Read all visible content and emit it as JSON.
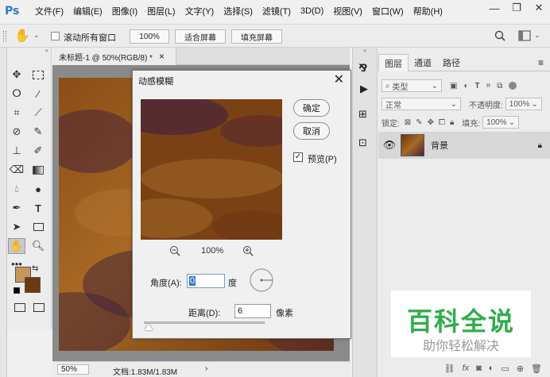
{
  "app": {
    "logo": "Ps"
  },
  "menu": [
    "文件(F)",
    "编辑(E)",
    "图像(I)",
    "图层(L)",
    "文字(Y)",
    "选择(S)",
    "滤镜(T)",
    "3D(D)",
    "视图(V)",
    "窗口(W)",
    "帮助(H)"
  ],
  "window_controls": {
    "minimize": "—",
    "restore": "❐",
    "close": "✕"
  },
  "options_bar": {
    "scroll_all_label": "滚动所有窗口",
    "zoom_value": "100%",
    "fit_screen_label": "适合屏幕",
    "fill_screen_label": "填充屏幕"
  },
  "document": {
    "tab_title": "未标题-1 @ 50%(RGB/8) *",
    "tab_close": "×",
    "status_zoom": "50%",
    "status_info": "文档:1.83M/1.83M"
  },
  "dialog": {
    "title": "动感模糊",
    "ok_label": "确定",
    "cancel_label": "取消",
    "preview_label": "预览(P)",
    "zoom_value": "100%",
    "angle_label": "角度(A):",
    "angle_value": "0",
    "angle_unit": "度",
    "distance_label": "距离(D):",
    "distance_value": "6",
    "distance_unit": "像素",
    "distance_slider_fraction": 0.02
  },
  "layers_panel": {
    "tabs": [
      "图层",
      "通道",
      "路径"
    ],
    "kind_filter": "类型",
    "blend_mode": "正常",
    "opacity_label": "不透明度:",
    "opacity_value": "100%",
    "lock_label": "锁定:",
    "fill_label": "填充:",
    "fill_value": "100%",
    "layer_name": "背景"
  },
  "watermark": {
    "title": "百科全说",
    "subtitle": "助你轻松解决"
  },
  "colors": {
    "foreground": "#c8965a",
    "background": "#6b3a12",
    "watermark_green": "#2eae4a"
  }
}
